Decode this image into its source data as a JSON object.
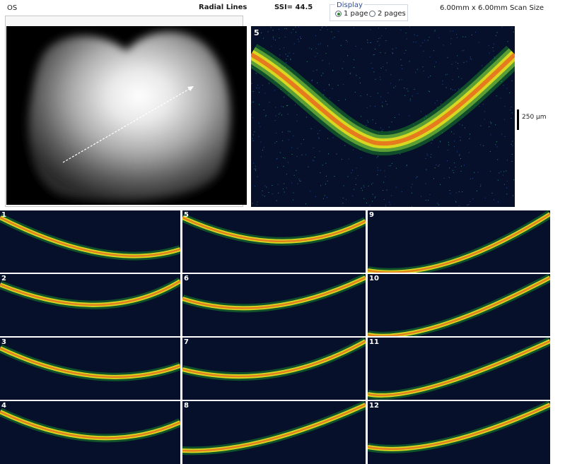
{
  "header": {
    "eye": "OS",
    "scan_type": "Radial Lines",
    "ssi": "SSI= 44.5",
    "display_title": "Display",
    "display_options": [
      "1 page",
      "2 pages"
    ],
    "display_selected": "1 page",
    "scan_size": "6.00mm x 6.00mm Scan Size"
  },
  "main_scan": {
    "label": "5",
    "scale_label": "250 µm"
  },
  "thumbnails": [
    {
      "label": "1"
    },
    {
      "label": "5"
    },
    {
      "label": "9"
    },
    {
      "label": "2"
    },
    {
      "label": "6"
    },
    {
      "label": "10"
    },
    {
      "label": "3"
    },
    {
      "label": "7"
    },
    {
      "label": "11"
    },
    {
      "label": "4"
    },
    {
      "label": "8"
    },
    {
      "label": "12"
    }
  ],
  "colors": {
    "scan_bg": "#06102a",
    "band_outer": "#1a8a2a",
    "band_mid": "#d8d820",
    "band_core": "#e86a20"
  }
}
